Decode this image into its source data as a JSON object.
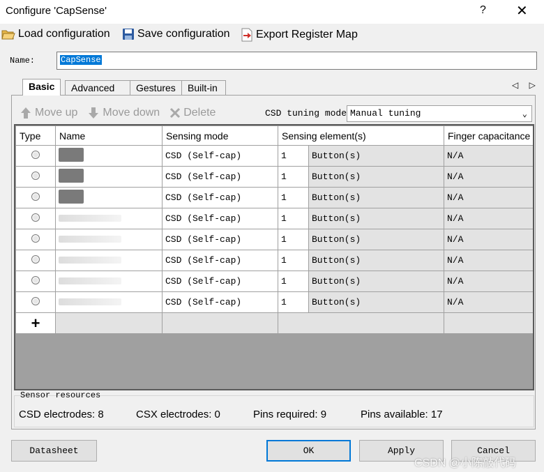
{
  "window": {
    "title": "Configure 'CapSense'",
    "help": "?",
    "close": "✕"
  },
  "toolbar": {
    "load": "Load configuration",
    "save": "Save configuration",
    "export": "Export Register Map"
  },
  "name_field": {
    "label": "Name:",
    "value": "CapSense"
  },
  "tabs": [
    "Basic",
    "Advanced",
    "Gestures",
    "Built-in"
  ],
  "tab_arrows": "◁ ▷",
  "row_actions": {
    "move_up": "Move up",
    "move_down": "Move down",
    "delete": "Delete"
  },
  "tuning": {
    "label": "CSD tuning mode",
    "value": "Manual tuning"
  },
  "table": {
    "headers": [
      "Type",
      "Name",
      "Sensing mode",
      "Sensing element(s)",
      "Finger capacitance"
    ],
    "rows": [
      {
        "mode": "CSD (Self-cap)",
        "count": "1",
        "element": "Button(s)",
        "finger": "N/A"
      },
      {
        "mode": "CSD (Self-cap)",
        "count": "1",
        "element": "Button(s)",
        "finger": "N/A"
      },
      {
        "mode": "CSD (Self-cap)",
        "count": "1",
        "element": "Button(s)",
        "finger": "N/A"
      },
      {
        "mode": "CSD (Self-cap)",
        "count": "1",
        "element": "Button(s)",
        "finger": "N/A"
      },
      {
        "mode": "CSD (Self-cap)",
        "count": "1",
        "element": "Button(s)",
        "finger": "N/A"
      },
      {
        "mode": "CSD (Self-cap)",
        "count": "1",
        "element": "Button(s)",
        "finger": "N/A"
      },
      {
        "mode": "CSD (Self-cap)",
        "count": "1",
        "element": "Button(s)",
        "finger": "N/A"
      },
      {
        "mode": "CSD (Self-cap)",
        "count": "1",
        "element": "Button(s)",
        "finger": "N/A"
      }
    ],
    "add_symbol": "+"
  },
  "resources": {
    "label": "Sensor resources",
    "csd": "CSD electrodes:  8",
    "csx": "CSX electrodes:  0",
    "pins_required": "Pins required:  9",
    "pins_available": "Pins available:  17"
  },
  "buttons": {
    "datasheet": "Datasheet",
    "ok": "OK",
    "apply": "Apply",
    "cancel": "Cancel"
  },
  "watermark": "CSDN @小陈敲代码"
}
